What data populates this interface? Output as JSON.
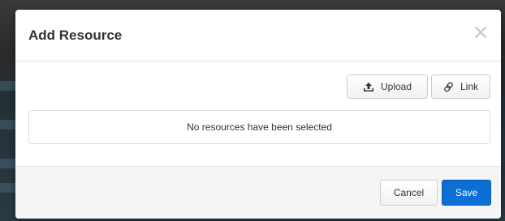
{
  "modal": {
    "title": "Add Resource",
    "close_glyph": "×",
    "close_icon": "close-icon"
  },
  "toolbar": {
    "upload_label": "Upload",
    "upload_icon": "upload-icon",
    "link_label": "Link",
    "link_icon": "link-icon"
  },
  "resources": {
    "empty_message": "No resources have been selected"
  },
  "footer": {
    "cancel_label": "Cancel",
    "save_label": "Save"
  },
  "colors": {
    "primary": "#0b6fd6",
    "footer_bg": "#f5f5f5",
    "title_text": "#333333"
  }
}
